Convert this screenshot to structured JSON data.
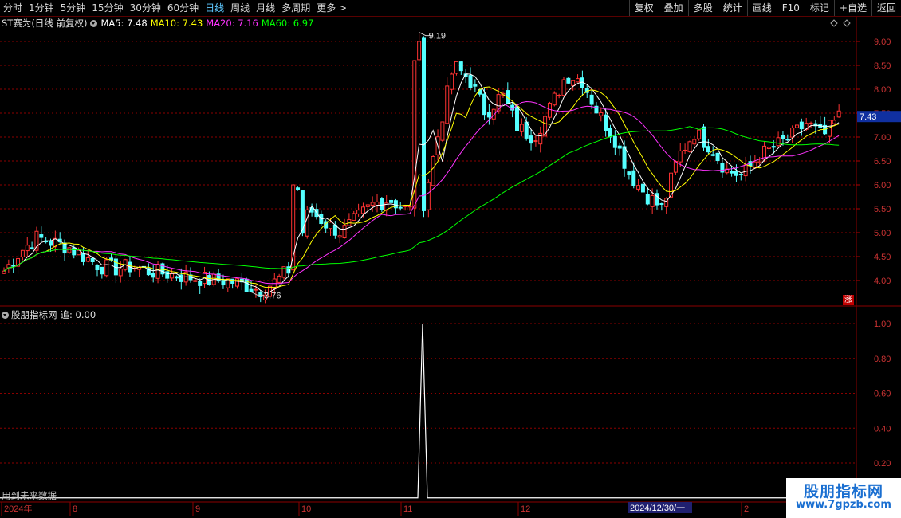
{
  "toolbar": {
    "periods": [
      "分时",
      "1分钟",
      "5分钟",
      "15分钟",
      "30分钟",
      "60分钟",
      "日线",
      "周线",
      "月线",
      "多周期",
      "更多"
    ],
    "active_period": "日线",
    "more_arrow": ">",
    "right_buttons": [
      "复权",
      "叠加",
      "多股",
      "统计",
      "画线",
      "F10",
      "标记",
      "+自选",
      "返回"
    ]
  },
  "main_legend": {
    "stock": "ST赛为(日线 前复权)",
    "ma5": "MA5: 7.48",
    "ma10": "MA10: 7.43",
    "ma20": "MA20: 7.16",
    "ma60": "MA60: 6.97"
  },
  "colors": {
    "ma5": "#ffffff",
    "ma10": "#ffff00",
    "ma20": "#ff33ff",
    "ma60": "#00ff00",
    "up": "#ff3333",
    "down": "#54ffff",
    "grid": "#8b0000",
    "price_tag_bg": "#1030a0"
  },
  "price_axis": {
    "labels": [
      "9.00",
      "8.50",
      "8.00",
      "7.50",
      "7.00",
      "6.50",
      "6.00",
      "5.50",
      "5.00",
      "4.50",
      "4.00"
    ],
    "current_price": "7.43"
  },
  "annotations": {
    "high": "9.19",
    "low": "3.76"
  },
  "sub_legend": {
    "name": "股朋指标网",
    "value": "追: 0.00"
  },
  "sub_axis": {
    "labels": [
      "1.00",
      "0.80",
      "0.60",
      "0.40",
      "0.20"
    ]
  },
  "date_axis": {
    "labels": [
      "2024年",
      "8",
      "9",
      "10",
      "11",
      "12",
      "2",
      "2024/12/30/一"
    ]
  },
  "zhang_icon": "涨",
  "future_data_text": "用到未来数据",
  "watermark": {
    "title": "股朋指标网",
    "url": "www.7gpzb.com"
  },
  "chart_data": {
    "type": "candlestick",
    "signal_series": {
      "name": "追",
      "values_note_free": [
        0,
        1,
        0
      ],
      "peak_value": 1.0
    },
    "price_range": [
      3.76,
      9.19
    ],
    "close_path": [
      4.2,
      4.6,
      4.9,
      4.8,
      4.7,
      4.5,
      4.3,
      4.25,
      4.3,
      4.2,
      4.15,
      4.1,
      4.05,
      4.0,
      4.0,
      3.9,
      3.8,
      4.0,
      4.3,
      5.5,
      5.2,
      5.0,
      5.3,
      5.6,
      5.7,
      5.5,
      5.4,
      7.0,
      8.5,
      8.2,
      7.5,
      7.9,
      7.2,
      7.0,
      7.6,
      8.3,
      8.2,
      7.5,
      7.0,
      6.2,
      5.8,
      5.5,
      6.6,
      7.1,
      6.8,
      6.3,
      6.2,
      6.6,
      6.8,
      7.0,
      7.3,
      7.0,
      7.43
    ]
  }
}
